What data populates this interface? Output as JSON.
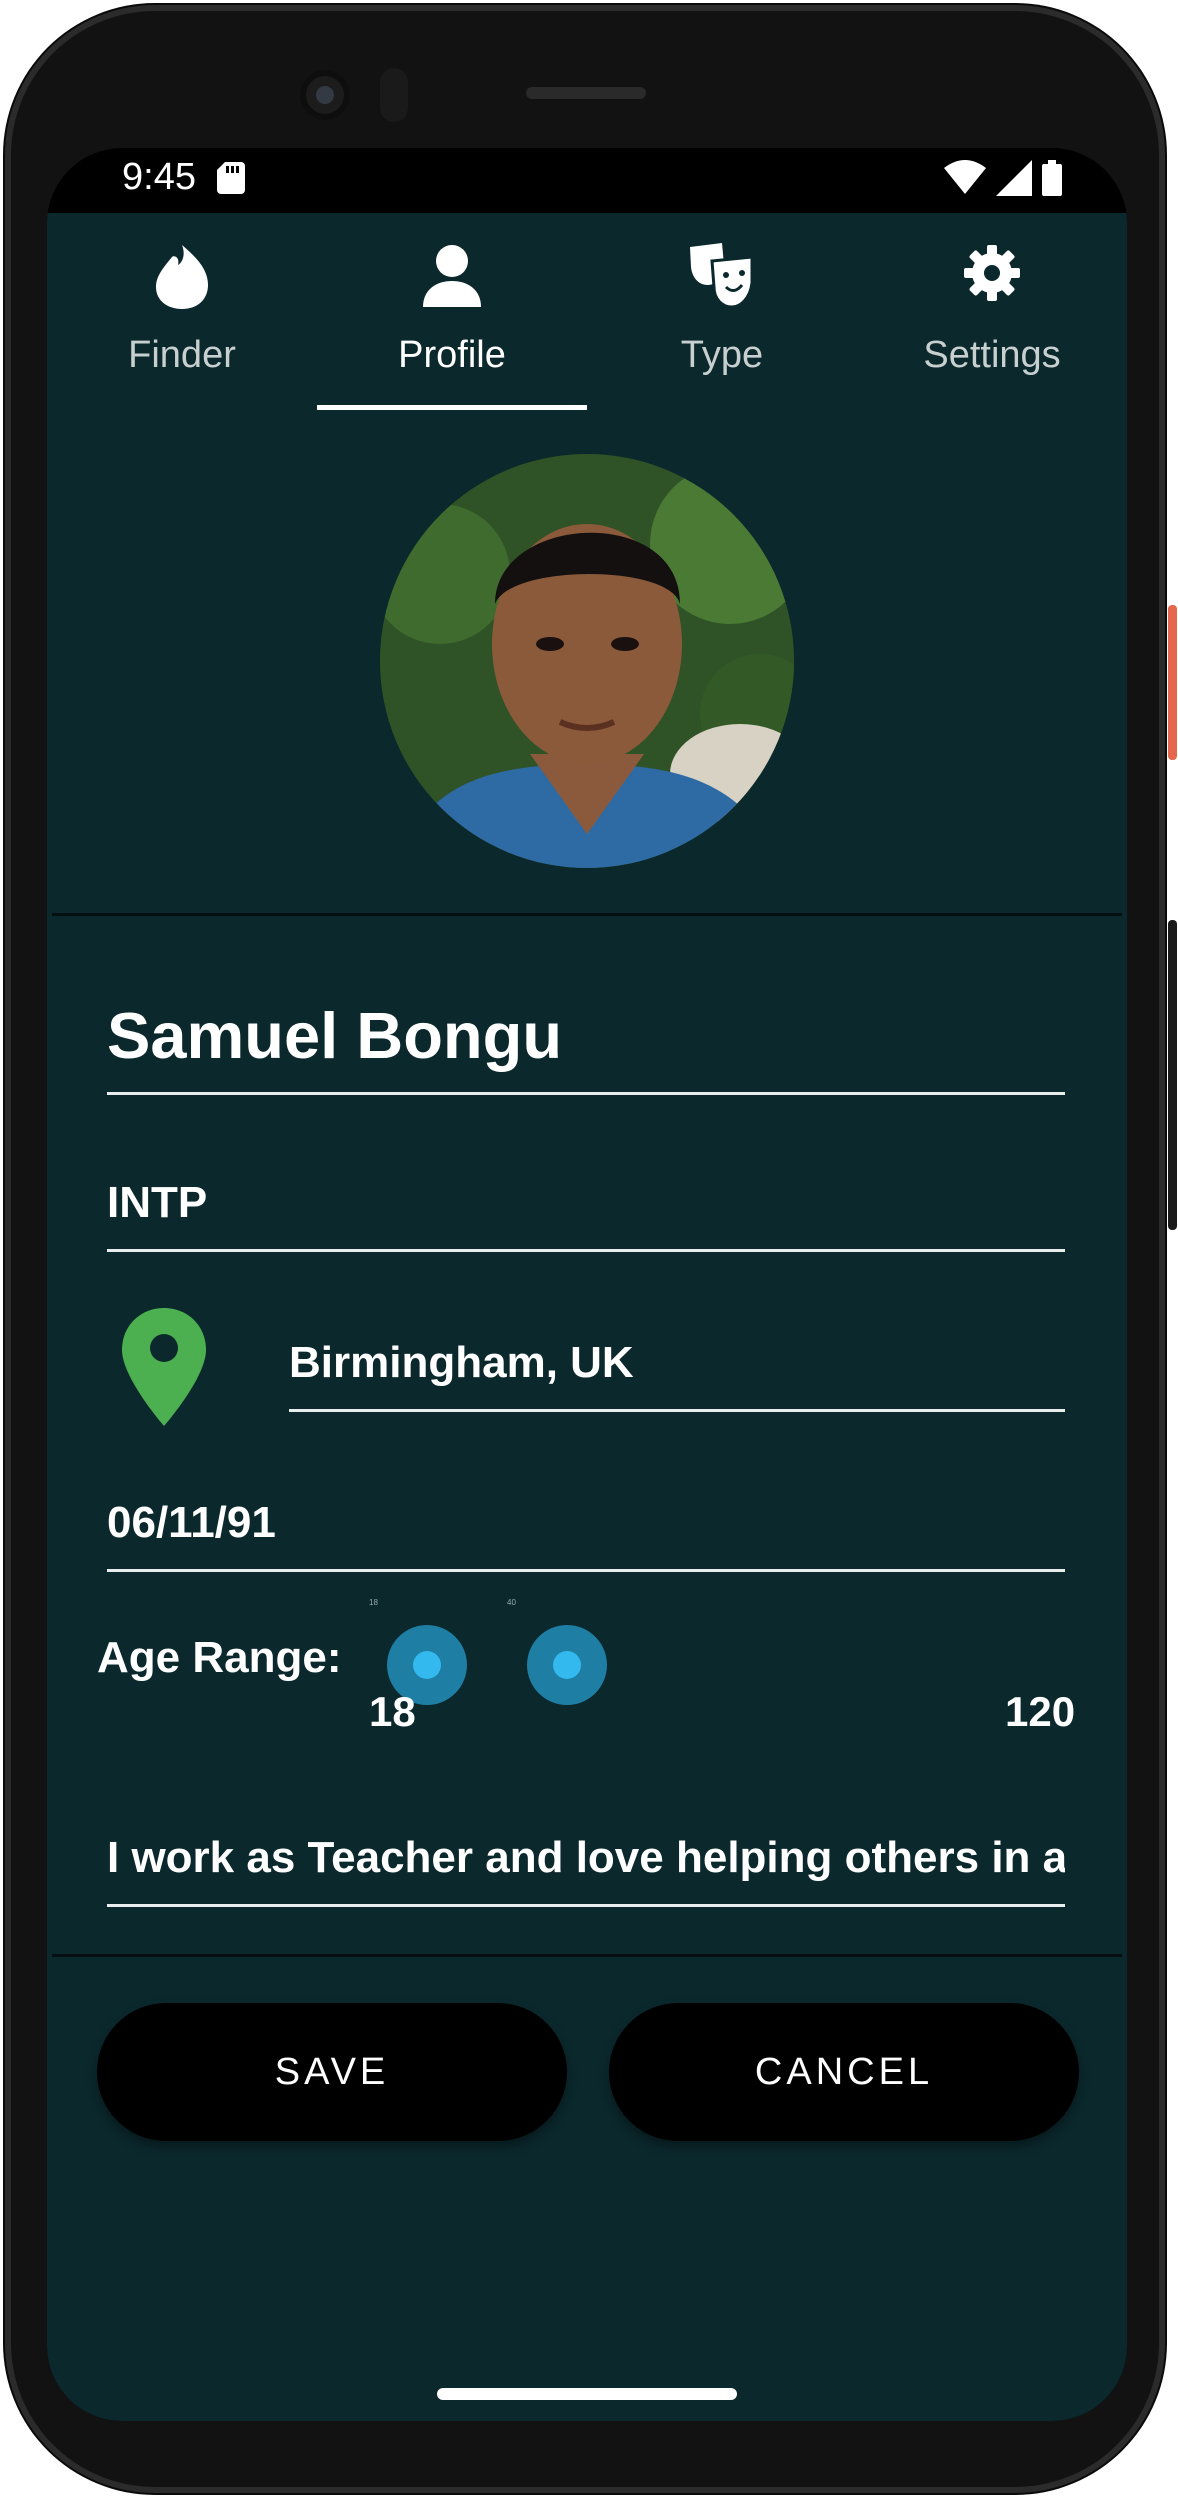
{
  "status": {
    "time": "9:45"
  },
  "tabs": [
    {
      "label": "Finder",
      "icon": "flame-icon"
    },
    {
      "label": "Profile",
      "icon": "person-icon"
    },
    {
      "label": "Type",
      "icon": "theater-masks-icon"
    },
    {
      "label": "Settings",
      "icon": "gear-icon"
    }
  ],
  "active_tab": "Profile",
  "profile": {
    "name": "Samuel Bongu",
    "personality_type": "INTP",
    "location": "Birmingham, UK",
    "date_of_birth": "06/11/91",
    "bio": "I work as Teacher and love helping others in add"
  },
  "age_range": {
    "label": "Age Range:",
    "min_value": "18",
    "max_value": "120",
    "selected_low": 18,
    "selected_high": 40
  },
  "buttons": {
    "save": "SAVE",
    "cancel": "CANCEL"
  },
  "colors": {
    "background": "#0b282d",
    "accent": "#33b9ee",
    "pin": "#4caf50"
  }
}
